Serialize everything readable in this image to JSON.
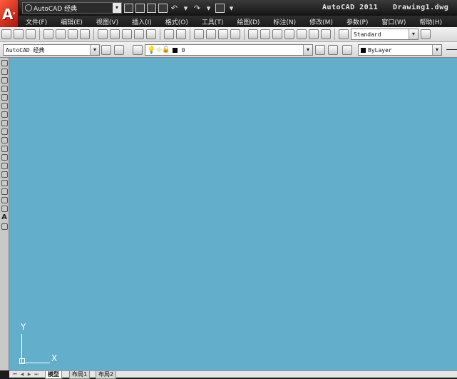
{
  "app": {
    "logo_letter": "A",
    "title": "AutoCAD 2011",
    "document": "Drawing1.dwg"
  },
  "workspace": {
    "value": "AutoCAD 经典"
  },
  "menus": [
    "文件(F)",
    "编辑(E)",
    "视图(V)",
    "插入(I)",
    "格式(O)",
    "工具(T)",
    "绘图(D)",
    "标注(N)",
    "修改(M)",
    "参数(P)",
    "窗口(W)",
    "帮助(H)"
  ],
  "toolbar2": {
    "workspace_combo": "AutoCAD 经典",
    "layer_combo": "0",
    "color_combo": "ByLayer"
  },
  "toolbar1": {
    "text_style_combo": "Standard"
  },
  "ucs": {
    "y_label": "Y",
    "x_label": "X"
  },
  "tabs": [
    {
      "label": "模型",
      "active": true
    },
    {
      "label": "布局1",
      "active": false
    },
    {
      "label": "布局2",
      "active": false
    }
  ],
  "colors": {
    "canvas": "#62aecb",
    "titlebar": "#1c1c1c",
    "logo": "#d0231a"
  }
}
